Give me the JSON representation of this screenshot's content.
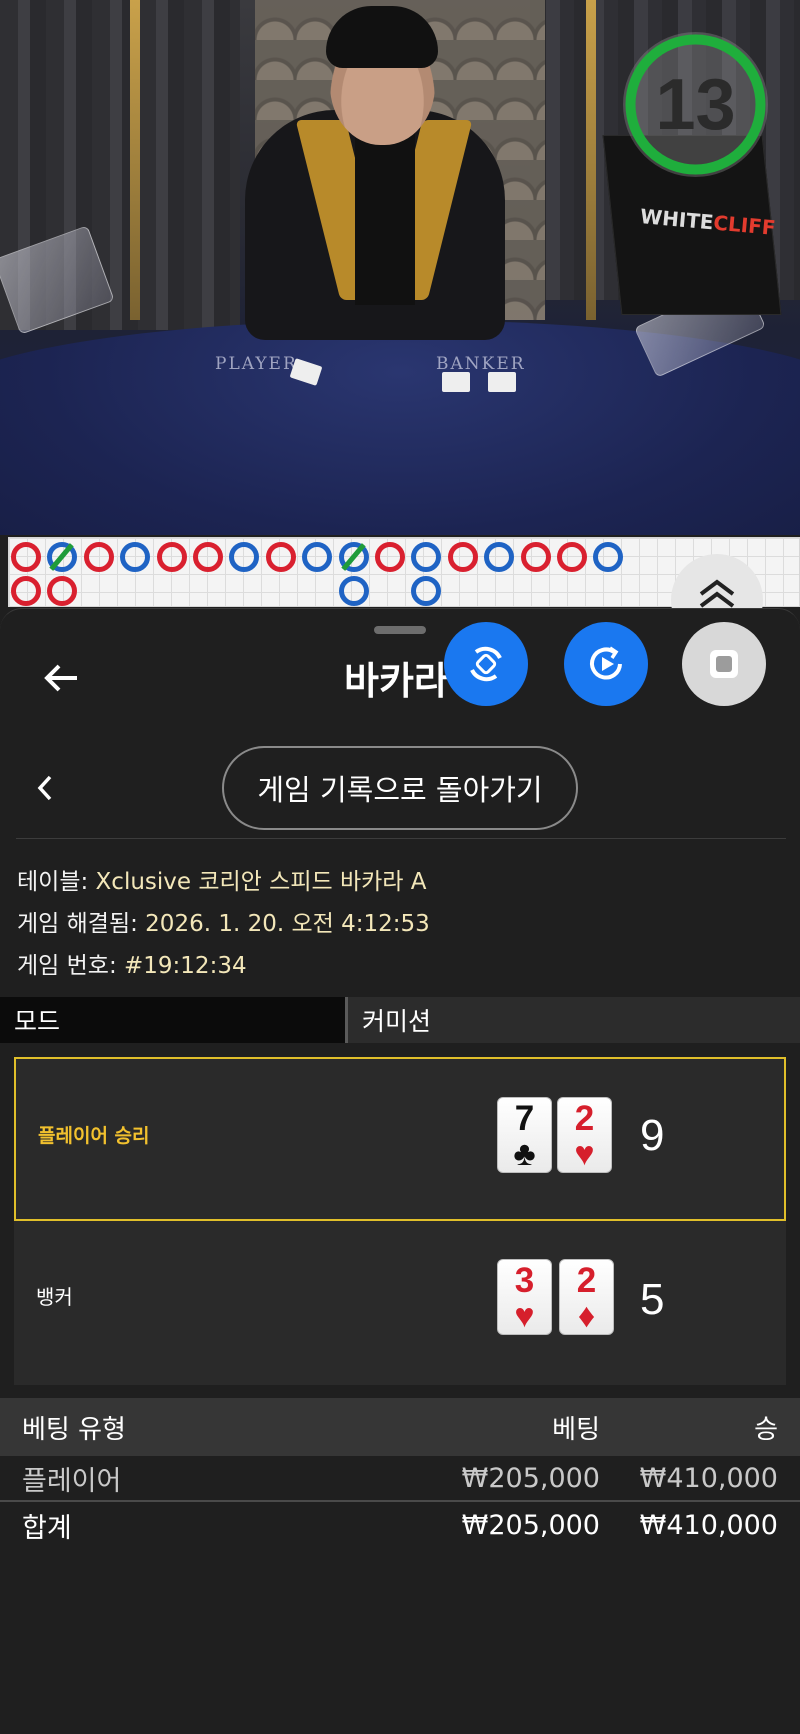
{
  "video": {
    "timer": "13",
    "felt_labels": {
      "player": "PLAYER",
      "banker": "BANKER"
    },
    "brand": {
      "white": "WHITE",
      "red": "CLIFF"
    }
  },
  "roadmap": {
    "row1": [
      "P",
      "B",
      "P",
      "B",
      "P",
      "P",
      "B",
      "P",
      "B",
      "B",
      "P",
      "B",
      "P",
      "B",
      "P",
      "P",
      "B"
    ],
    "row2": [
      "P",
      "P",
      "",
      "",
      "",
      "",
      "",
      "",
      "",
      "B",
      "",
      "B"
    ]
  },
  "sheet": {
    "title": "바카라",
    "back_to_history": "게임 기록으로 돌아가기",
    "info": {
      "table_label": "테이블: ",
      "table_value": "Xclusive 코리안 스피드 바카라 A",
      "resolved_label": "게임 해결됨: ",
      "resolved_value": "2026. 1. 20. 오전 4:12:53",
      "game_no_label": "게임 번호: ",
      "game_no_value": "#19:12:34"
    },
    "mode_tabs": [
      "모드",
      "커미션"
    ],
    "hands": [
      {
        "label": "플레이어 승리",
        "winner": true,
        "cards": [
          {
            "rank": "7",
            "suit": "♣",
            "color": "black"
          },
          {
            "rank": "2",
            "suit": "♥",
            "color": "red"
          }
        ],
        "score": "9"
      },
      {
        "label": "뱅커",
        "winner": false,
        "cards": [
          {
            "rank": "3",
            "suit": "♥",
            "color": "red"
          },
          {
            "rank": "2",
            "suit": "♦",
            "color": "red"
          }
        ],
        "score": "5"
      }
    ],
    "bets": {
      "headers": {
        "type": "베팅 유형",
        "bet": "베팅",
        "win": "승"
      },
      "rows": [
        {
          "type": "플레이어",
          "bet": "₩205,000",
          "win": "₩410,000"
        }
      ],
      "total": {
        "type": "합계",
        "bet": "₩205,000",
        "win": "₩410,000"
      }
    }
  },
  "colors": {
    "accent_blue": "#1a78f0",
    "win_gold": "#e0bf2a",
    "timer_green": "#1fae3c",
    "player_red": "#d9202f",
    "banker_blue": "#1f63c4"
  },
  "icons": {
    "back": "arrow-left-icon",
    "prev": "chevron-left-icon",
    "fab1": "rotate-camera-icon",
    "fab2": "replay-icon",
    "fab3": "stop-icon",
    "scroll": "double-chevron-up-icon"
  }
}
